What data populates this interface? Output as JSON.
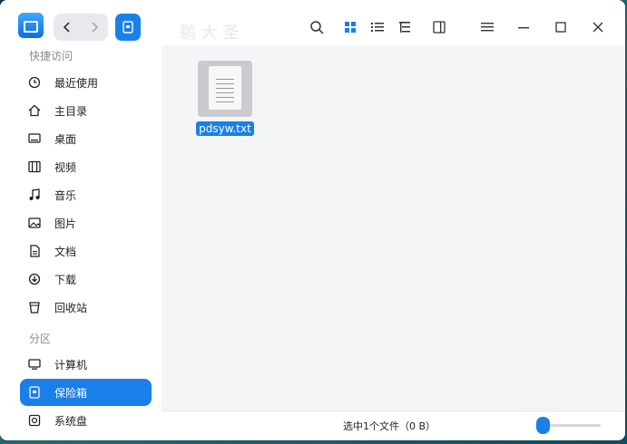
{
  "toolbar": {
    "back_icon": "chevron-left-icon",
    "forward_icon": "chevron-right-icon",
    "location_icon": "vault-icon",
    "search_icon": "search-icon",
    "icon_view_icon": "grid-view-icon",
    "list_view_icon": "list-view-icon",
    "tree_view_icon": "tree-view-icon",
    "detail_pane_icon": "split-pane-icon",
    "menu_icon": "menu-icon",
    "minimize_icon": "minimize-icon",
    "maximize_icon": "maximize-icon",
    "close_icon": "close-icon"
  },
  "sidebar": {
    "quick_access_title": "快捷访问",
    "quick_items": [
      {
        "label": "最近使用",
        "icon": "clock-icon"
      },
      {
        "label": "主目录",
        "icon": "home-icon"
      },
      {
        "label": "桌面",
        "icon": "desktop-icon"
      },
      {
        "label": "视频",
        "icon": "video-icon"
      },
      {
        "label": "音乐",
        "icon": "music-icon"
      },
      {
        "label": "图片",
        "icon": "image-icon"
      },
      {
        "label": "文档",
        "icon": "document-icon"
      },
      {
        "label": "下载",
        "icon": "download-icon"
      },
      {
        "label": "回收站",
        "icon": "trash-icon"
      }
    ],
    "partition_title": "分区",
    "partition_items": [
      {
        "label": "计算机",
        "icon": "computer-icon"
      },
      {
        "label": "保险箱",
        "icon": "vault-icon",
        "active": true
      },
      {
        "label": "系统盘",
        "icon": "disk-icon"
      }
    ]
  },
  "files": [
    {
      "name": "pdsyw.txt",
      "icon": "text-file-icon",
      "selected": true
    }
  ],
  "status": {
    "text": "选中1个文件（0 B）"
  },
  "watermark": "鹏 大 圣",
  "colors": {
    "accent": "#1a7fe8"
  }
}
